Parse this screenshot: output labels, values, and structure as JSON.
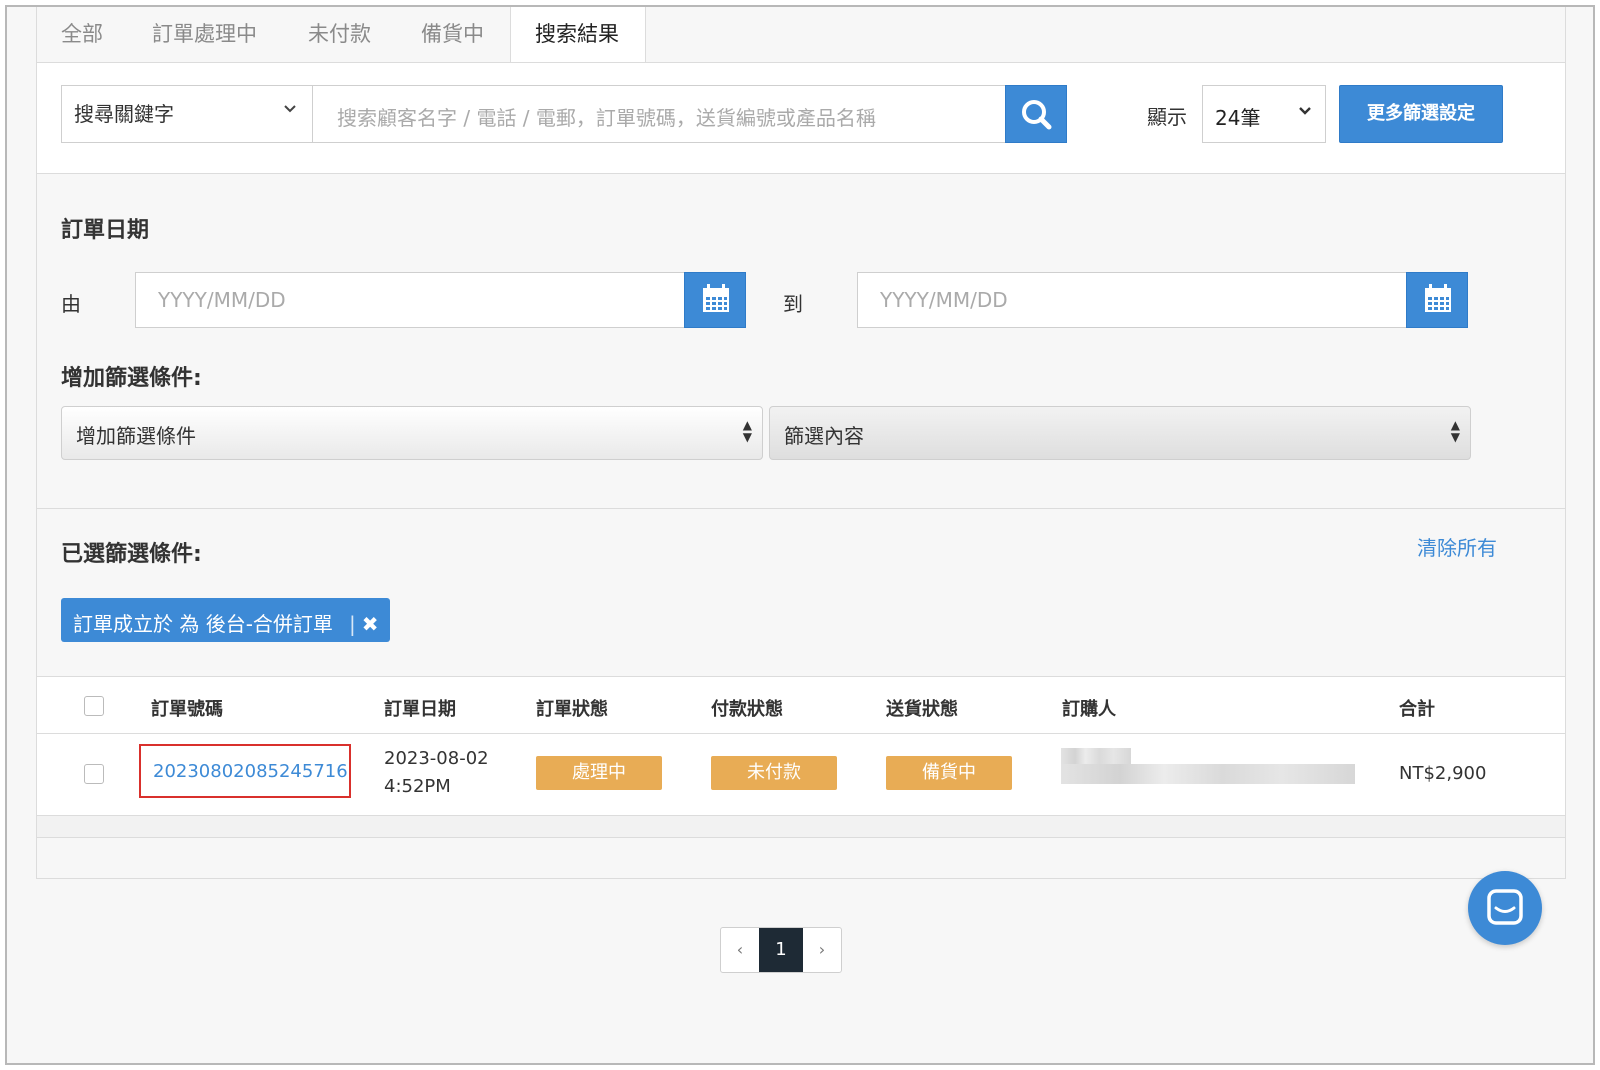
{
  "tabs": [
    {
      "label": "全部"
    },
    {
      "label": "訂單處理中"
    },
    {
      "label": "未付款"
    },
    {
      "label": "備貨中"
    },
    {
      "label": "搜索結果",
      "active": true
    }
  ],
  "search": {
    "keyword_select": "搜尋關鍵字",
    "placeholder": "搜索顧客名字 / 電話 / 電郵，訂單號碼，送貨編號或產品名稱",
    "show_label": "顯示",
    "per_page": "24筆",
    "more_filters": "更多篩選設定"
  },
  "date_filter": {
    "title": "訂單日期",
    "from_label": "由",
    "to_label": "到",
    "from_placeholder": "YYYY/MM/DD",
    "to_placeholder": "YYYY/MM/DD"
  },
  "add_filter": {
    "title": "增加篩選條件:",
    "condition_select": "增加篩選條件",
    "content_select": "篩選內容"
  },
  "selected_filters": {
    "title": "已選篩選條件:",
    "clear_all": "清除所有",
    "chips": [
      {
        "label": "訂單成立於 為 後台-合併訂單"
      }
    ]
  },
  "table": {
    "headers": {
      "order_no": "訂單號碼",
      "order_date": "訂單日期",
      "order_status": "訂單狀態",
      "payment_status": "付款狀態",
      "delivery_status": "送貨狀態",
      "customer": "訂購人",
      "total": "合計"
    },
    "rows": [
      {
        "order_no": "20230802085245716",
        "date": "2023-08-02",
        "time": "4:52PM",
        "order_status": "處理中",
        "payment_status": "未付款",
        "delivery_status": "備貨中",
        "total": "NT$2,900"
      }
    ]
  },
  "pagination": {
    "prev": "‹",
    "current": "1",
    "next": "›"
  },
  "colors": {
    "primary": "#3d8ad6",
    "badge": "#e8ac55",
    "highlight": "#d9302c"
  },
  "icons": [
    "search-icon",
    "calendar-icon",
    "chevron-down-icon",
    "close-icon",
    "chat-icon"
  ]
}
